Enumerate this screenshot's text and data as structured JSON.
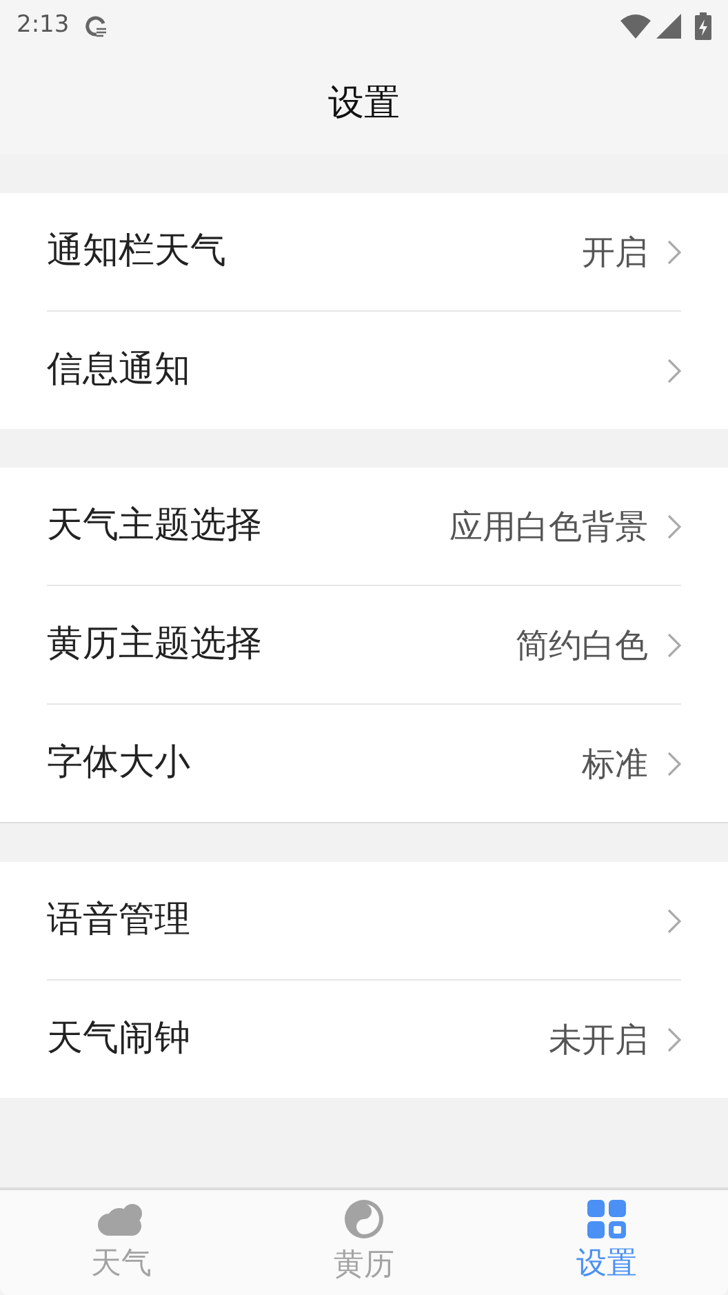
{
  "status_bar": {
    "time": "2:13"
  },
  "header": {
    "title": "设置"
  },
  "groups": [
    {
      "rows": [
        {
          "label": "通知栏天气",
          "value": "开启"
        },
        {
          "label": "信息通知"
        }
      ]
    },
    {
      "rows": [
        {
          "label": "天气主题选择",
          "value": "应用白色背景"
        },
        {
          "label": "黄历主题选择",
          "value": "简约白色"
        },
        {
          "label": "字体大小",
          "value": "标准"
        }
      ]
    },
    {
      "rows": [
        {
          "label": "语音管理"
        },
        {
          "label": "天气闹钟",
          "value": "未开启"
        }
      ]
    }
  ],
  "tabs": [
    {
      "kind": "weather",
      "label": "天气",
      "selected": false
    },
    {
      "kind": "almanac",
      "label": "黄历",
      "selected": false
    },
    {
      "kind": "settings",
      "label": "设置",
      "selected": true
    }
  ]
}
